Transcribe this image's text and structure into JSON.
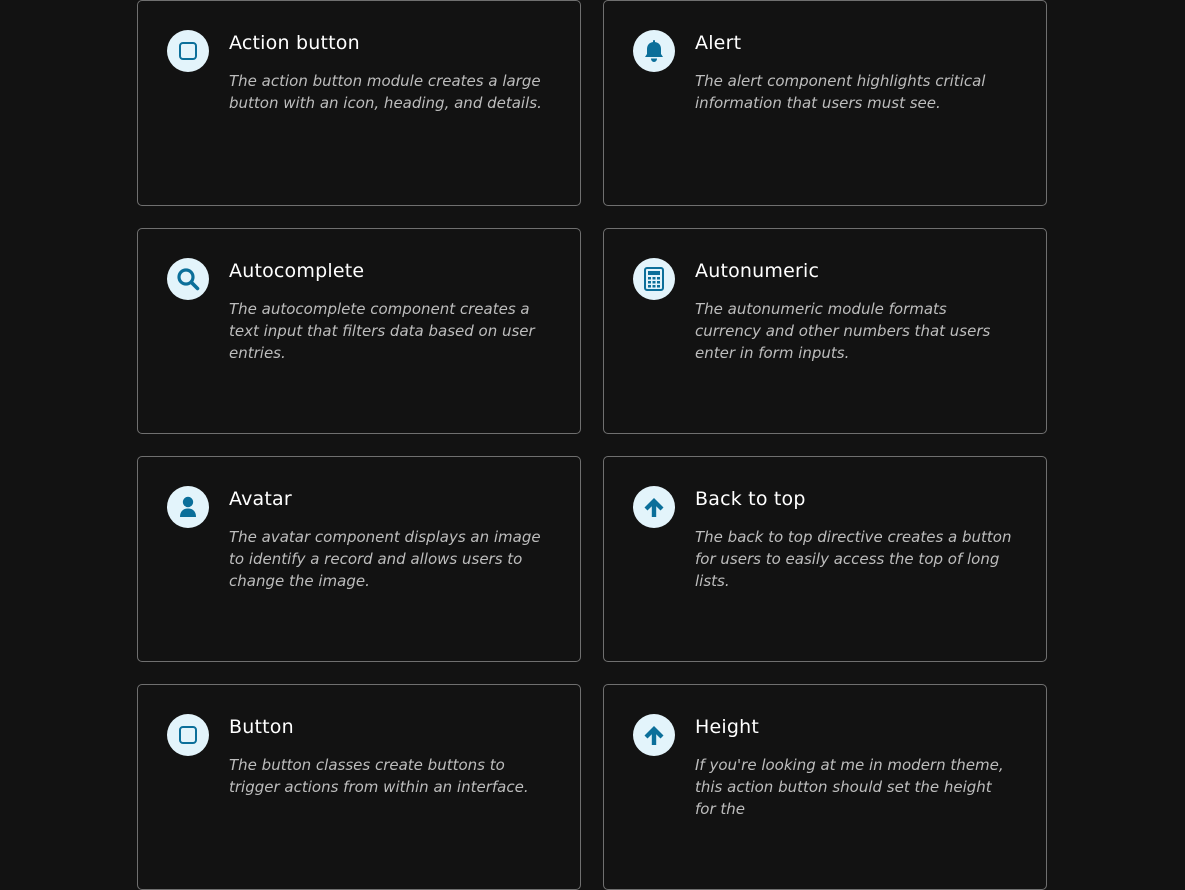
{
  "accent": "#0b6f9a",
  "icon_bg": "#e3f4fb",
  "cards": [
    {
      "icon": "square-icon",
      "title": "Action button",
      "description": "The action button module creates a large button with an icon, heading, and details."
    },
    {
      "icon": "bell-icon",
      "title": "Alert",
      "description": "The alert component highlights critical information that users must see."
    },
    {
      "icon": "search-icon",
      "title": "Autocomplete",
      "description": "The autocomplete component creates a text input that filters data based on user entries."
    },
    {
      "icon": "calculator-icon",
      "title": "Autonumeric",
      "description": "The autonumeric module formats currency and other numbers that users enter in form inputs."
    },
    {
      "icon": "user-icon",
      "title": "Avatar",
      "description": "The avatar component displays an image to identify a record and allows users to change the image."
    },
    {
      "icon": "arrow-up-icon",
      "title": "Back to top",
      "description": "The back to top directive creates a button for users to easily access the top of long lists."
    },
    {
      "icon": "square-icon",
      "title": "Button",
      "description": "The button classes create buttons to trigger actions from within an interface."
    },
    {
      "icon": "arrow-up-icon",
      "title": "Height",
      "description": "If you're looking at me in modern theme, this action button should set the height for the"
    }
  ]
}
